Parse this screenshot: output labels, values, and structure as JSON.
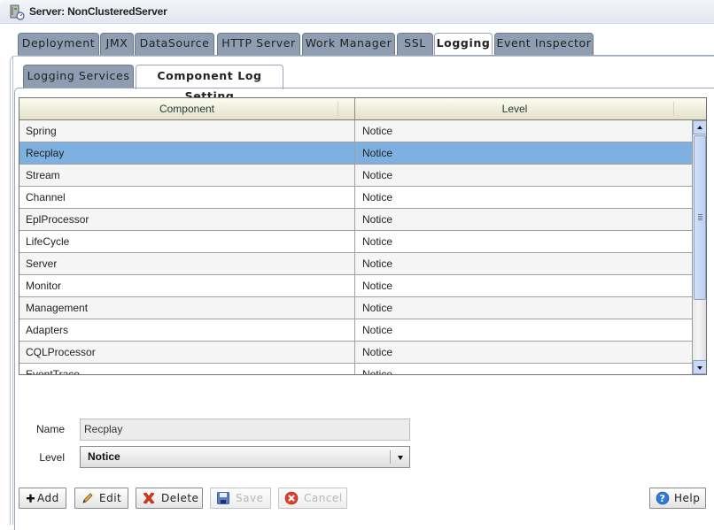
{
  "window": {
    "title": "Server: NonClusteredServer",
    "icon": "server-icon"
  },
  "tabs": [
    {
      "label": "Deployment",
      "active": false
    },
    {
      "label": "JMX",
      "active": false
    },
    {
      "label": "DataSource",
      "active": false
    },
    {
      "label": "HTTP Server",
      "active": false
    },
    {
      "label": "Work Manager",
      "active": false
    },
    {
      "label": "SSL",
      "active": false
    },
    {
      "label": "Logging",
      "active": true
    },
    {
      "label": "Event Inspector",
      "active": false
    }
  ],
  "subtabs": [
    {
      "label": "Logging Services",
      "active": false
    },
    {
      "label": "Component Log Setting",
      "active": true
    }
  ],
  "grid": {
    "columns": [
      "Component",
      "Level"
    ],
    "rows": [
      {
        "component": "Spring",
        "level": "Notice",
        "selected": false
      },
      {
        "component": "Recplay",
        "level": "Notice",
        "selected": true
      },
      {
        "component": "Stream",
        "level": "Notice",
        "selected": false
      },
      {
        "component": "Channel",
        "level": "Notice",
        "selected": false
      },
      {
        "component": "EplProcessor",
        "level": "Notice",
        "selected": false
      },
      {
        "component": "LifeCycle",
        "level": "Notice",
        "selected": false
      },
      {
        "component": "Server",
        "level": "Notice",
        "selected": false
      },
      {
        "component": "Monitor",
        "level": "Notice",
        "selected": false
      },
      {
        "component": "Management",
        "level": "Notice",
        "selected": false
      },
      {
        "component": "Adapters",
        "level": "Notice",
        "selected": false
      },
      {
        "component": "CQLProcessor",
        "level": "Notice",
        "selected": false
      },
      {
        "component": "EventTrace",
        "level": "Notice",
        "selected": false
      }
    ],
    "selected_color": "#7eb1e2"
  },
  "form": {
    "name_label": "Name",
    "name_value": "Recplay",
    "level_label": "Level",
    "level_value": "Notice"
  },
  "buttons": {
    "add": "Add",
    "edit": "Edit",
    "delete": "Delete",
    "save": "Save",
    "cancel": "Cancel",
    "help": "Help"
  }
}
